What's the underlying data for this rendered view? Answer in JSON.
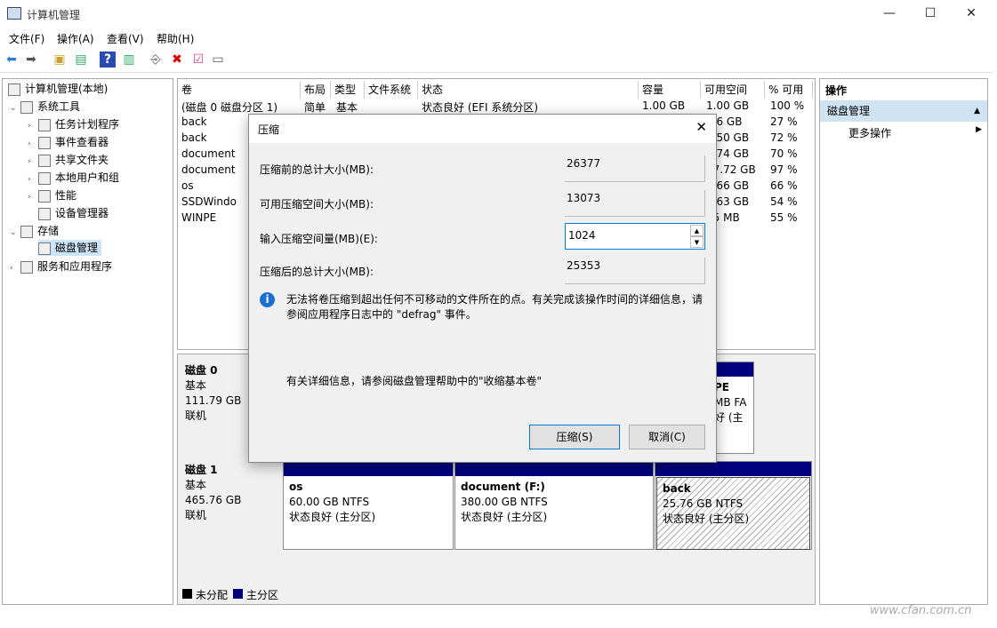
{
  "window": {
    "title": "计算机管理",
    "min": "—",
    "max": "☐",
    "close": "✕"
  },
  "menu": [
    "文件(F)",
    "操作(A)",
    "查看(V)",
    "帮助(H)"
  ],
  "tree": {
    "root": "计算机管理(本地)",
    "system_tools": "系统工具",
    "items": [
      "任务计划程序",
      "事件查看器",
      "共享文件夹",
      "本地用户和组",
      "性能",
      "设备管理器"
    ],
    "storage": "存储",
    "disk_mgmt": "磁盘管理",
    "services": "服务和应用程序"
  },
  "volumes": {
    "headers": [
      "卷",
      "布局",
      "类型",
      "文件系统",
      "状态",
      "容量",
      "可用空间",
      "% 可用"
    ],
    "rows": [
      [
        "(磁盘 0 磁盘分区 1)",
        "简单",
        "基本",
        "",
        "状态良好 (EFI 系统分区)",
        "1.00 GB",
        "1.00 GB",
        "100 %"
      ],
      [
        "back",
        "",
        "",
        "",
        "",
        "",
        ".96 GB",
        "27 %"
      ],
      [
        "back",
        "",
        "",
        "",
        "",
        "",
        "3.50 GB",
        "72 %"
      ],
      [
        "document",
        "",
        "",
        "",
        "",
        "",
        "1.74 GB",
        "70 %"
      ],
      [
        "document",
        "",
        "",
        "",
        "",
        "",
        "57.72 GB",
        "97 %"
      ],
      [
        "os",
        "",
        "",
        "",
        "",
        "",
        "9.66 GB",
        "66 %"
      ],
      [
        "SSDWindo",
        "",
        "",
        "",
        "",
        "",
        "4.63 GB",
        "54 %"
      ],
      [
        "WINPE",
        "",
        "",
        "",
        "",
        "",
        "55 MB",
        "55 %"
      ]
    ]
  },
  "disks": [
    {
      "name": "磁盘 0",
      "type": "基本",
      "size": "111.79 GB",
      "status": "联机",
      "partial": [
        "PE",
        "MB FA",
        "好 (主"
      ]
    },
    {
      "name": "磁盘 1",
      "type": "基本",
      "size": "465.76 GB",
      "status": "联机",
      "parts": [
        {
          "name": "os",
          "size": "60.00 GB NTFS",
          "state": "状态良好 (主分区)"
        },
        {
          "name": "document  (F:)",
          "size": "380.00 GB NTFS",
          "state": "状态良好 (主分区)"
        },
        {
          "name": "back",
          "size": "25.76 GB NTFS",
          "state": "状态良好 (主分区)"
        }
      ]
    }
  ],
  "legend": [
    "未分配",
    "主分区"
  ],
  "ops": {
    "title": "操作",
    "section": "磁盘管理",
    "more": "更多操作"
  },
  "dialog": {
    "title": "压缩",
    "fields": [
      {
        "label": "压缩前的总计大小(MB):",
        "value": "26377"
      },
      {
        "label": "可用压缩空间大小(MB):",
        "value": "13073"
      },
      {
        "label": "输入压缩空间量(MB)(E):",
        "value": "1024"
      },
      {
        "label": "压缩后的总计大小(MB):",
        "value": "25353"
      }
    ],
    "info": "无法将卷压缩到超出任何不可移动的文件所在的点。有关完成该操作时间的详细信息，请参阅应用程序日志中的 \"defrag\" 事件。",
    "help": "有关详细信息，请参阅磁盘管理帮助中的\"收缩基本卷\"",
    "ok": "压缩(S)",
    "cancel": "取消(C)"
  },
  "watermark": "www.cfan.com.cn",
  "colors": {
    "primary_partition": "#00007f",
    "accent": "#0078d7",
    "ops_header": "#cfe3f3"
  }
}
